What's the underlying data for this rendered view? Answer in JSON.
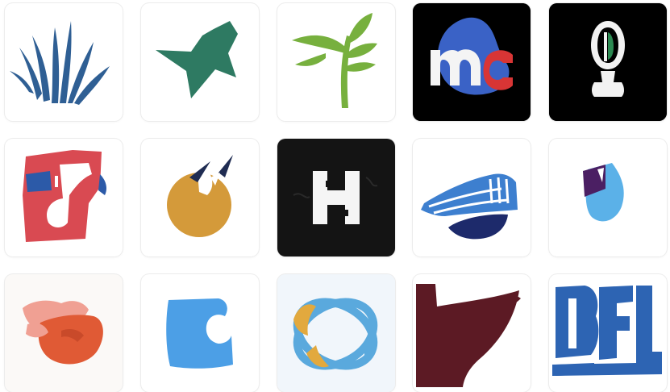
{
  "logos": [
    {
      "name": "blue-grass-logo",
      "fill": "#2f5f94"
    },
    {
      "name": "green-star-logo",
      "fill": "#2e7a62"
    },
    {
      "name": "green-sprout-logo",
      "fill": "#77b03e"
    },
    {
      "name": "mc-blob-logo",
      "primary": "#3a62c6",
      "secondary": "#d83535",
      "letter": "#f4f4f4",
      "background": "#000000"
    },
    {
      "name": "microphone-logo",
      "primary": "#f2f2f2",
      "accent": "#2c8a52",
      "background": "#000000"
    },
    {
      "name": "red-blocks-logo",
      "primary": "#d94a52",
      "secondary": "#2c5aa8",
      "background": "#ffffff"
    },
    {
      "name": "orange-ball-logo",
      "primary": "#d49a3a",
      "accent": "#1f2c52"
    },
    {
      "name": "h-block-logo",
      "primary": "#f5f5f5",
      "background": "#141414"
    },
    {
      "name": "blue-wave-logo",
      "primary": "#3d7fcf",
      "accent": "#1d2a6b"
    },
    {
      "name": "purple-drop-logo",
      "primary": "#5bb1e8",
      "accent": "#4b1f63"
    },
    {
      "name": "coral-blob-logo",
      "primary": "#e05a35",
      "secondary": "#f0a093"
    },
    {
      "name": "blue-c-logo",
      "primary": "#4c9fe6"
    },
    {
      "name": "atom-petals-logo",
      "primary": "#5aa9dd",
      "secondary": "#e2a93e",
      "background": "#f1f6fb"
    },
    {
      "name": "maroon-flag-logo",
      "primary": "#5c1a24"
    },
    {
      "name": "blue-letters-logo",
      "primary": "#2d64b3"
    }
  ]
}
